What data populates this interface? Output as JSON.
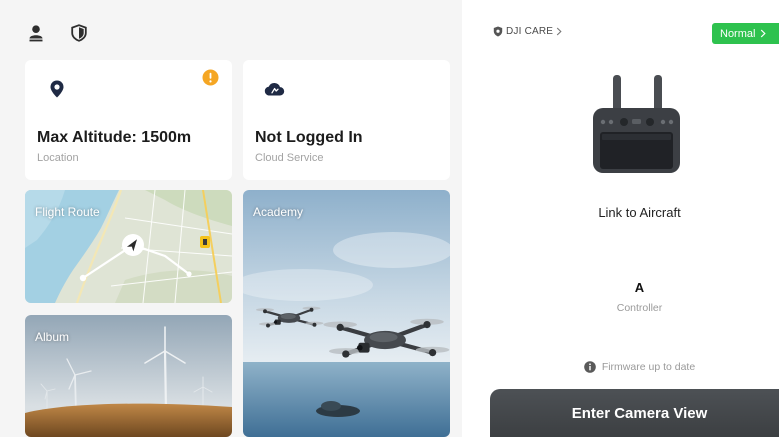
{
  "top_bar": {
    "profile_icon": "user-icon",
    "safety_icon": "shield-icon"
  },
  "cards": {
    "location": {
      "title": "Max Altitude: 1500m",
      "subtitle": "Location",
      "icon": "location-pin-icon",
      "badge_icon": "warning-icon"
    },
    "cloud_service": {
      "title": "Not Logged In",
      "subtitle": "Cloud Service",
      "icon": "cloud-icon"
    },
    "flight_route": {
      "label": "Flight Route"
    },
    "academy": {
      "label": "Academy"
    },
    "album": {
      "label": "Album"
    }
  },
  "device_panel": {
    "care": {
      "label": "DJI CARE",
      "icon": "dji-care-icon"
    },
    "status_badge": {
      "label": "Normal"
    },
    "link_label": "Link to Aircraft",
    "device_name": "A",
    "device_type": "Controller",
    "firmware_status": "Firmware up to date",
    "firmware_icon": "info-icon",
    "primary_button": "Enter Camera View"
  },
  "colors": {
    "status_ok": "#2ec24e",
    "warning": "#f5a623",
    "icon_dark": "#1f2a44",
    "button_dark": "#434649",
    "text_primary": "#1c1c1c",
    "text_secondary": "#a3a3a3"
  }
}
